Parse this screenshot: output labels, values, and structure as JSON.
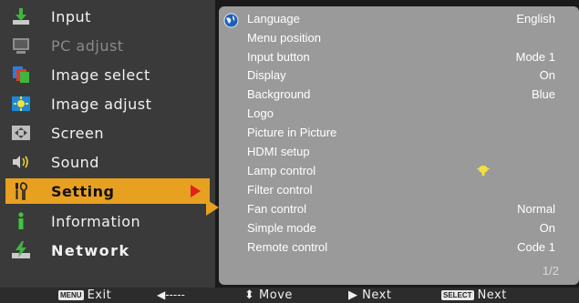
{
  "menu": {
    "items": [
      {
        "label": "Input",
        "icon": "input-icon",
        "state": "normal"
      },
      {
        "label": "PC adjust",
        "icon": "pc-adjust-icon",
        "state": "disabled"
      },
      {
        "label": "Image select",
        "icon": "image-select-icon",
        "state": "normal"
      },
      {
        "label": "Image adjust",
        "icon": "image-adjust-icon",
        "state": "normal"
      },
      {
        "label": "Screen",
        "icon": "screen-icon",
        "state": "normal"
      },
      {
        "label": "Sound",
        "icon": "sound-icon",
        "state": "normal"
      },
      {
        "label": "Setting",
        "icon": "setting-icon",
        "state": "selected"
      },
      {
        "label": "Information",
        "icon": "information-icon",
        "state": "normal"
      },
      {
        "label": "Network",
        "icon": "network-icon",
        "state": "normal"
      }
    ]
  },
  "settings": {
    "rows": [
      {
        "label": "Language",
        "value": "English"
      },
      {
        "label": "Menu position",
        "value": ""
      },
      {
        "label": "Input button",
        "value": "Mode 1"
      },
      {
        "label": "Display",
        "value": "On"
      },
      {
        "label": "Background",
        "value": "Blue"
      },
      {
        "label": "Logo",
        "value": ""
      },
      {
        "label": "Picture in Picture",
        "value": ""
      },
      {
        "label": "HDMI setup",
        "value": ""
      },
      {
        "label": "Lamp control",
        "value": ""
      },
      {
        "label": "Filter control",
        "value": ""
      },
      {
        "label": "Fan control",
        "value": "Normal"
      },
      {
        "label": "Simple mode",
        "value": "On"
      },
      {
        "label": "Remote control",
        "value": "Code 1"
      }
    ],
    "page": "1/2"
  },
  "footer": {
    "menu_key": "MENU",
    "exit_label": "Exit",
    "back_label": "◀-----",
    "move_label": "⬍ Move",
    "next_label": "▶ Next",
    "select_key": "SELECT",
    "select_next_label": "Next"
  },
  "colors": {
    "selected_bg": "#e8a020",
    "arrow": "#e0201a",
    "panel_bg": "#9a9a9a",
    "menu_bg": "#3a3a3a"
  }
}
